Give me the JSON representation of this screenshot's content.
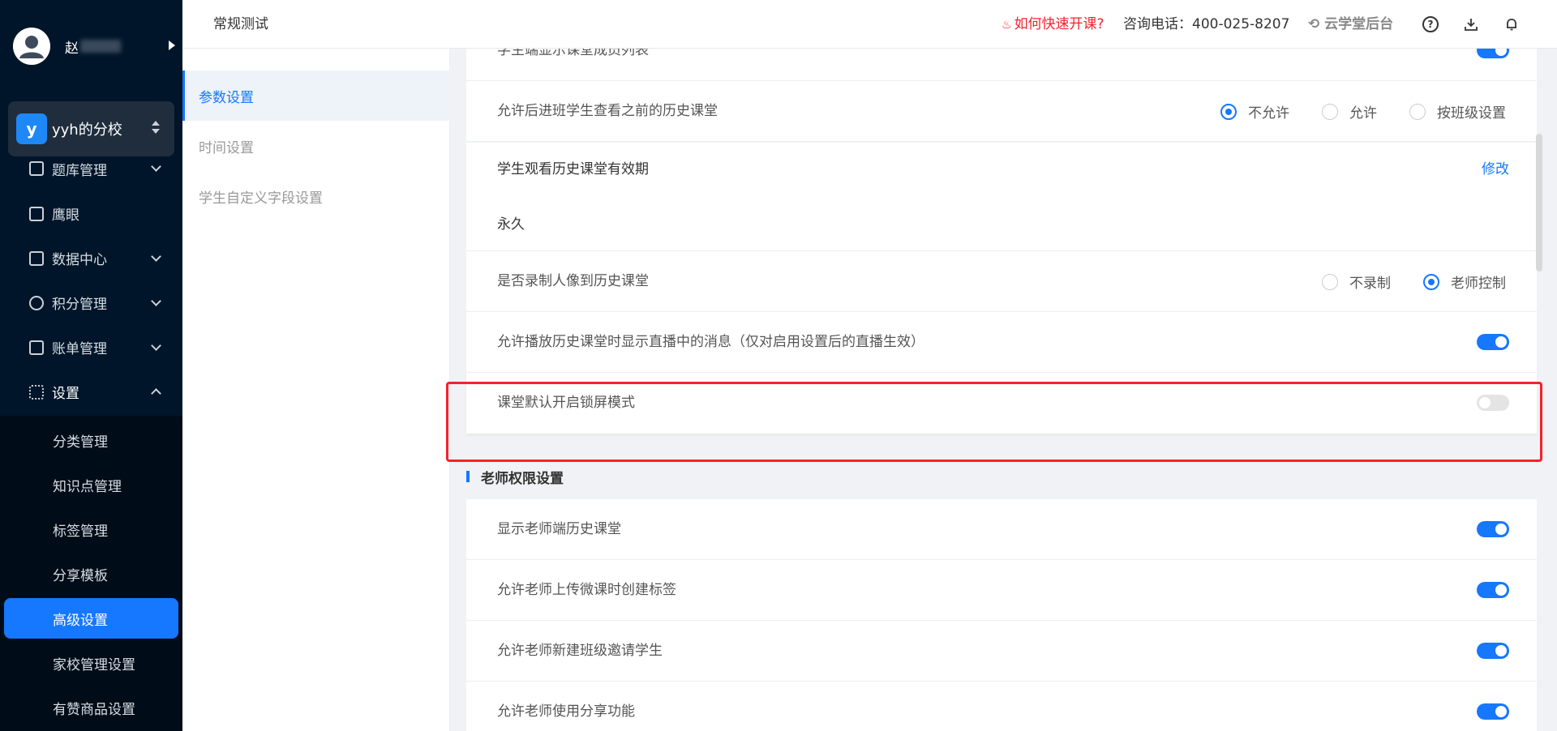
{
  "sidebar": {
    "user_name": "赵",
    "school_badge": "y",
    "school_name": "yyh的分校",
    "nav": [
      {
        "label": "题库管理",
        "icon": "book-icon"
      },
      {
        "label": "鹰眼",
        "icon": "eye-icon"
      },
      {
        "label": "数据中心",
        "icon": "chart-icon"
      },
      {
        "label": "积分管理",
        "icon": "star-icon"
      },
      {
        "label": "账单管理",
        "icon": "bill-icon"
      },
      {
        "label": "设置",
        "icon": "grid-icon"
      }
    ],
    "sub_items": [
      "分类管理",
      "知识点管理",
      "标签管理",
      "分享模板",
      "高级设置",
      "家校管理设置",
      "有赞商品设置"
    ]
  },
  "topbar": {
    "breadcrumb": "常规测试",
    "quick_link": "如何快速开课?",
    "phone": "咨询电话：400-025-8207",
    "backend": "云学堂后台"
  },
  "subnav": {
    "items": [
      "参数设置",
      "时间设置",
      "学生自定义字段设置"
    ]
  },
  "settings": {
    "top_cut": "学生端显示课堂成员列表",
    "history_access": {
      "label": "允许后进班学生查看之前的历史课堂",
      "options": [
        "不允许",
        "允许",
        "按班级设置"
      ],
      "selected": "不允许"
    },
    "validity": {
      "label": "学生观看历史课堂有效期",
      "edit": "修改",
      "value": "永久"
    },
    "record_portrait": {
      "label": "是否录制人像到历史课堂",
      "options": [
        "不录制",
        "老师控制"
      ],
      "selected": "老师控制"
    },
    "show_live_msg": {
      "label": "允许播放历史课堂时显示直播中的消息（仅对启用设置后的直播生效）",
      "on": true
    },
    "lock_screen": {
      "label": "课堂默认开启锁屏模式",
      "on": false
    },
    "teacher_section": "老师权限设置",
    "teacher_rows": [
      {
        "label": "显示老师端历史课堂",
        "on": true
      },
      {
        "label": "允许老师上传微课时创建标签",
        "on": true
      },
      {
        "label": "允许老师新建班级邀请学生",
        "on": true
      },
      {
        "label": "允许老师使用分享功能",
        "on": true
      }
    ]
  },
  "colors": {
    "primary": "#1677ff",
    "sidebar_bg": "#001529",
    "highlight": "#f5222d"
  }
}
